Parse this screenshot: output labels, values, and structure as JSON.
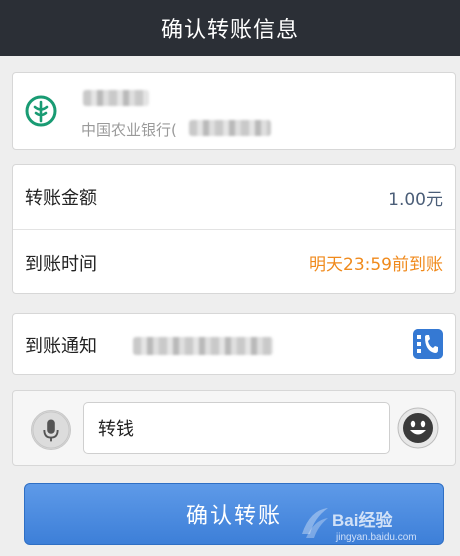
{
  "header": {
    "title": "确认转账信息"
  },
  "payee": {
    "bank_name": "中国农业银行(",
    "bank_icon": "agricultural-bank-logo"
  },
  "transfer": {
    "amount_label": "转账金额",
    "amount_value": "1.00元",
    "time_label": "到账时间",
    "time_value": "明天23:59前到账"
  },
  "notify": {
    "label": "到账通知",
    "contact_icon": "contact-phone-icon"
  },
  "message": {
    "value": "转钱",
    "mic_icon": "microphone-icon",
    "emoji_icon": "smiley-icon"
  },
  "actions": {
    "confirm_label": "确认转账"
  },
  "watermark": {
    "text": "Bai经验",
    "url": "jingyan.baidu.com"
  },
  "colors": {
    "header_bg": "#2b2f36",
    "accent_blue": "#3d7fd8",
    "arrival_orange": "#f08a1c",
    "bank_green": "#199b73"
  }
}
